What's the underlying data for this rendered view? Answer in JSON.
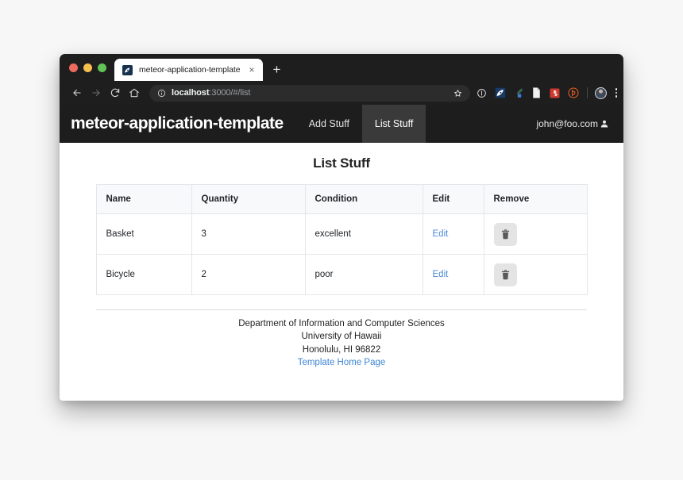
{
  "browser": {
    "traffic_lights": [
      "close",
      "minimize",
      "maximize"
    ],
    "tab": {
      "title": "meteor-application-template",
      "favicon_name": "meteor-favicon",
      "close_label": "×"
    },
    "new_tab_label": "+",
    "toolbar": {
      "back_label": "←",
      "forward_label": "→",
      "reload_label": "⟳",
      "home_label": "⌂",
      "url_host": "localhost",
      "url_rest": ":3000/#/list",
      "info_icon": "info-circle-icon",
      "star_icon": "bookmark-star-icon",
      "extensions": [
        "info-circle-extension-icon",
        "meteor-extension-icon",
        "eyedropper-extension-icon",
        "document-extension-icon",
        "puzzle-extension-icon",
        "bitly-extension-icon"
      ],
      "profile_icon": "profile-avatar",
      "menu_icon": "kebab-menu-icon"
    }
  },
  "navbar": {
    "brand": "meteor-application-template",
    "items": [
      {
        "label": "Add Stuff",
        "active": false
      },
      {
        "label": "List Stuff",
        "active": true
      }
    ],
    "user": {
      "email": "john@foo.com",
      "icon": "user-icon"
    },
    "background_color": "#1d1d1d",
    "active_color": "#3a3a3a"
  },
  "main": {
    "title": "List Stuff",
    "table": {
      "columns": [
        "Name",
        "Quantity",
        "Condition",
        "Edit",
        "Remove"
      ],
      "rows": [
        {
          "name": "Basket",
          "quantity": "3",
          "condition": "excellent",
          "edit_label": "Edit",
          "remove_icon": "trash-icon"
        },
        {
          "name": "Bicycle",
          "quantity": "2",
          "condition": "poor",
          "edit_label": "Edit",
          "remove_icon": "trash-icon"
        }
      ]
    }
  },
  "footer": {
    "line1": "Department of Information and Computer Sciences",
    "line2": "University of Hawaii",
    "line3": "Honolulu, HI 96822",
    "link": "Template Home Page"
  },
  "colors": {
    "page_background": "#f7f7f7",
    "navbar": "#1d1d1d",
    "link": "#4a88d6",
    "table_header": "#f8f9fa",
    "border": "#e3e6ea"
  }
}
